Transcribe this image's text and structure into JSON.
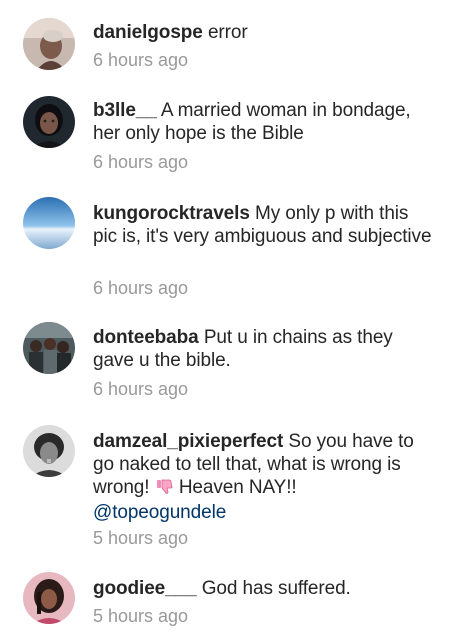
{
  "comments": [
    {
      "username": "danielgospe",
      "text": "error",
      "time": "6 hours ago",
      "avatar_icon": "profile-photo"
    },
    {
      "username": "b3lle__",
      "text": "A married woman in bondage, her only hope is the Bible",
      "time": "6 hours ago",
      "avatar_icon": "profile-photo"
    },
    {
      "username": "kungorocktravels",
      "text": "My only p with this pic is, it's very ambiguous and subjective",
      "time": "6 hours ago",
      "avatar_icon": "sky-photo"
    },
    {
      "username": "donteebaba",
      "text": "Put u in chains as they gave u the bible.",
      "time": "6 hours ago",
      "avatar_icon": "group-photo"
    },
    {
      "username": "damzeal_pixieperfect",
      "text": "So you have to go naked to tell that, what is wrong is wrong!",
      "text_after_emoji": "Heaven NAY!!",
      "emoji": "thumbs-down-icon",
      "mention": "@topeogundele",
      "time": "5 hours ago",
      "avatar_icon": "profile-photo"
    },
    {
      "username": "goodiee___",
      "text": "God has suffered.",
      "time": "5 hours ago",
      "avatar_icon": "profile-photo"
    }
  ],
  "colors": {
    "username": "#262626",
    "body_text": "#262626",
    "timestamp": "#999999",
    "mention": "#003569"
  }
}
